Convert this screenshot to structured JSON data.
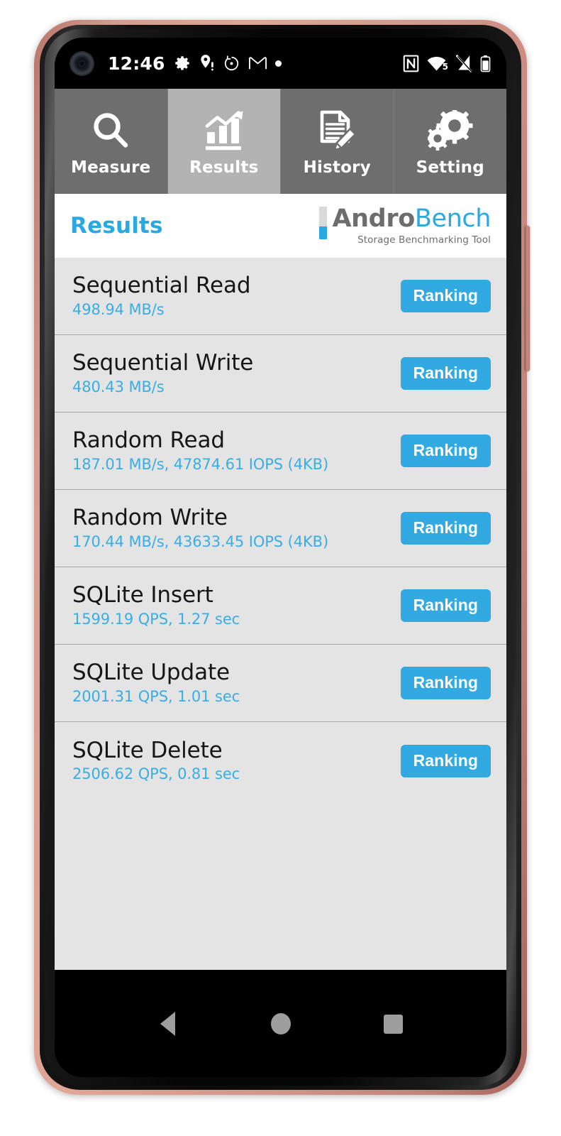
{
  "status_bar": {
    "time": "12:46",
    "left_icons": [
      "gear-icon",
      "location-pin-alert-icon",
      "timer-icon",
      "gmail-icon",
      "dot-icon"
    ],
    "right_icons": [
      "nfc-icon",
      "wifi-5-icon",
      "signal-off-icon",
      "battery-icon"
    ],
    "wifi_label": "5"
  },
  "tabs": [
    {
      "label": "Measure",
      "icon": "magnifier-icon",
      "selected": false
    },
    {
      "label": "Results",
      "icon": "bar-chart-arrow-icon",
      "selected": true
    },
    {
      "label": "History",
      "icon": "document-pencil-icon",
      "selected": false
    },
    {
      "label": "Setting",
      "icon": "gears-icon",
      "selected": false
    }
  ],
  "header": {
    "title": "Results",
    "logo_andro": "Andro",
    "logo_bench": "Bench",
    "logo_tagline": "Storage Benchmarking Tool"
  },
  "results": [
    {
      "title": "Sequential Read",
      "value": "498.94 MB/s",
      "button": "Ranking"
    },
    {
      "title": "Sequential Write",
      "value": "480.43 MB/s",
      "button": "Ranking"
    },
    {
      "title": "Random Read",
      "value": "187.01 MB/s, 47874.61 IOPS (4KB)",
      "button": "Ranking"
    },
    {
      "title": "Random Write",
      "value": "170.44 MB/s, 43633.45 IOPS (4KB)",
      "button": "Ranking"
    },
    {
      "title": "SQLite Insert",
      "value": "1599.19 QPS, 1.27 sec",
      "button": "Ranking"
    },
    {
      "title": "SQLite Update",
      "value": "2001.31 QPS, 1.01 sec",
      "button": "Ranking"
    },
    {
      "title": "SQLite Delete",
      "value": "2506.62 QPS, 0.81 sec",
      "button": "Ranking"
    }
  ],
  "nav_bar": {
    "back": "back-triangle-icon",
    "home": "home-circle-icon",
    "recents": "recents-square-icon"
  },
  "colors": {
    "accent_blue": "#2aa9e0",
    "button_blue": "#32aae1",
    "tab_bg": "#6e6e6e",
    "tab_selected_bg": "#b3b3b3",
    "list_bg": "#e4e4e4",
    "frame_body": "#d79c8f"
  }
}
